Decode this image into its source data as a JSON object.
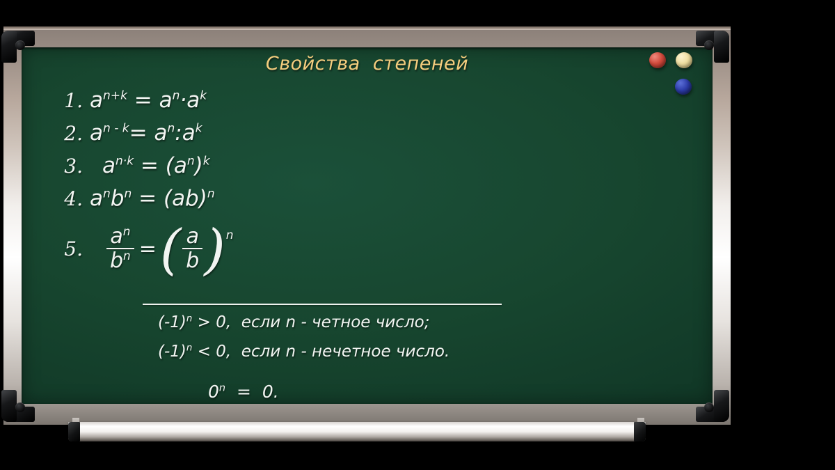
{
  "board": {
    "title": "Свойства  степеней",
    "surface_color": "#164632",
    "frame_color": "#e8e4e0",
    "title_color": "#f4cd7e",
    "chalk_color": "#f2f5f2"
  },
  "formulas": [
    {
      "number": "1.",
      "base_left": "a",
      "exp_left": "n+k",
      "operator": " = ",
      "right": "aⁿ·aᵏ",
      "plain": "aⁿ⁺ᵏ = aⁿ·aᵏ"
    },
    {
      "number": "2.",
      "plain": "aⁿ ⁻ ᵏ= aⁿ:aᵏ"
    },
    {
      "number": "3.",
      "plain": "aⁿ·ᵏ = (aⁿ)ᵏ"
    },
    {
      "number": "4.",
      "plain": "aⁿbⁿ = (ab)ⁿ"
    },
    {
      "number": "5.",
      "plain": "aⁿ/bⁿ = (a/b)ⁿ",
      "fraction": {
        "left_num_base": "a",
        "left_num_exp": "n",
        "left_den_base": "b",
        "left_den_exp": "n",
        "equals": "=",
        "right_num": "a",
        "right_den": "b",
        "right_exp": "n",
        "paren_open": "(",
        "paren_close": ")"
      }
    }
  ],
  "formula_parts": {
    "f1_num": "1.",
    "f1_text": "a",
    "f1_sup": "n+k",
    "f1_eq": " = ",
    "f1_a": "a",
    "f1_sup2": "n",
    "f1_dot": "·",
    "f1_b": "a",
    "f1_sup3": "k",
    "f2_num": "2.",
    "f2_a": "a",
    "f2_sup": "n - k",
    "f2_eq": "= ",
    "f2_b": "a",
    "f2_sup2": "n",
    "f2_colon": ":",
    "f2_c": "a",
    "f2_sup3": "k",
    "f3_num": "3.",
    "f3_a": "a",
    "f3_sup": "n·k",
    "f3_eq": " = ",
    "f3_open": "(a",
    "f3_sup2": "n",
    "f3_close": ")",
    "f3_sup3": "k",
    "f4_num": "4.",
    "f4_a": "a",
    "f4_sup": "n",
    "f4_b": "b",
    "f4_sup2": "n",
    "f4_eq": " = ",
    "f4_ab": "(ab)",
    "f4_sup3": "n",
    "f5_num": "5."
  },
  "divider": {
    "visible": true
  },
  "notes": [
    {
      "id": "note-even",
      "prefix": "(-1)",
      "exp": "n",
      "rest": " > 0,  если n - четное число;",
      "plain": "(-1)ⁿ > 0,  если n - четное число;"
    },
    {
      "id": "note-odd",
      "prefix": "(-1)",
      "exp": "n",
      "rest": " < 0,  если n - нечетное число.",
      "plain": "(-1)ⁿ < 0,  если n - нечетное число."
    },
    {
      "id": "note-zero",
      "prefix": "0",
      "exp": "n",
      "rest": "  =  0.",
      "plain": "0ⁿ  =  0."
    }
  ],
  "magnets": [
    {
      "name": "magnet-red",
      "color": "#d24a3c"
    },
    {
      "name": "magnet-cream",
      "color": "#f0dfa2"
    },
    {
      "name": "magnet-blue",
      "color": "#2c3ba8"
    }
  ]
}
